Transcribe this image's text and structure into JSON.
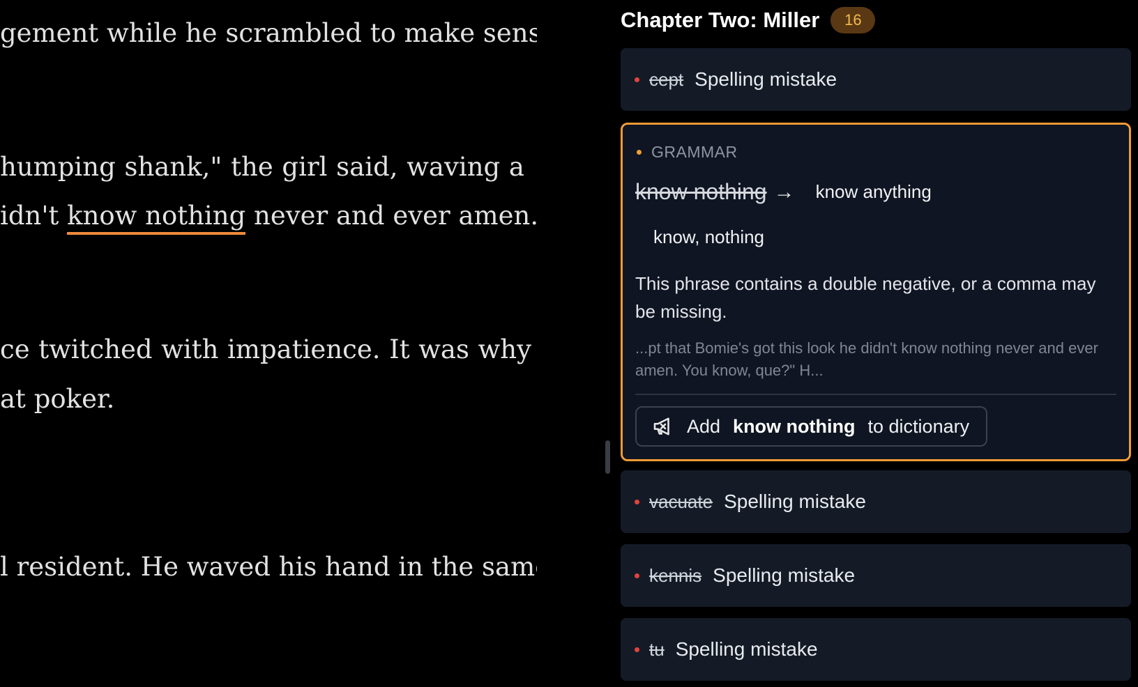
{
  "editor": {
    "lines": [
      "gement while he scrambled to make sense",
      "humping shank,\" the girl said, waving a",
      "idn't ",
      "know nothing",
      " never and ever amen.",
      "ce twitched with impatience. It was why",
      "at poker.",
      "l resident. He waved his hand in the same"
    ]
  },
  "sidebar": {
    "title": "Chapter Two: Miller",
    "count": "16",
    "issues_top": [
      {
        "word": "cept",
        "label": "Spelling mistake"
      }
    ],
    "active": {
      "category": "GRAMMAR",
      "original": "know nothing",
      "arrow": "→",
      "suggestions": [
        "know anything",
        "know, nothing"
      ],
      "message": "This phrase contains a double negative, or a comma may be missing.",
      "context": "...pt that Bomie's got this look he didn't know nothing never and ever amen. You know, que?\" H...",
      "add_prefix": "Add",
      "add_word": "know nothing",
      "add_suffix": "to dictionary"
    },
    "issues_bottom": [
      {
        "word": "vacuate",
        "label": "Spelling mistake"
      },
      {
        "word": "kennis",
        "label": "Spelling mistake"
      },
      {
        "word": "tu",
        "label": "Spelling mistake"
      }
    ]
  },
  "colors": {
    "accent": "#f29b35",
    "spelling_dot": "#e0453c",
    "grammar_dot": "#f0a030",
    "card_bg": "#141b27",
    "badge_bg": "#5a3814",
    "badge_text": "#f3b94d"
  },
  "icons": [
    "megaphone-off-icon"
  ]
}
